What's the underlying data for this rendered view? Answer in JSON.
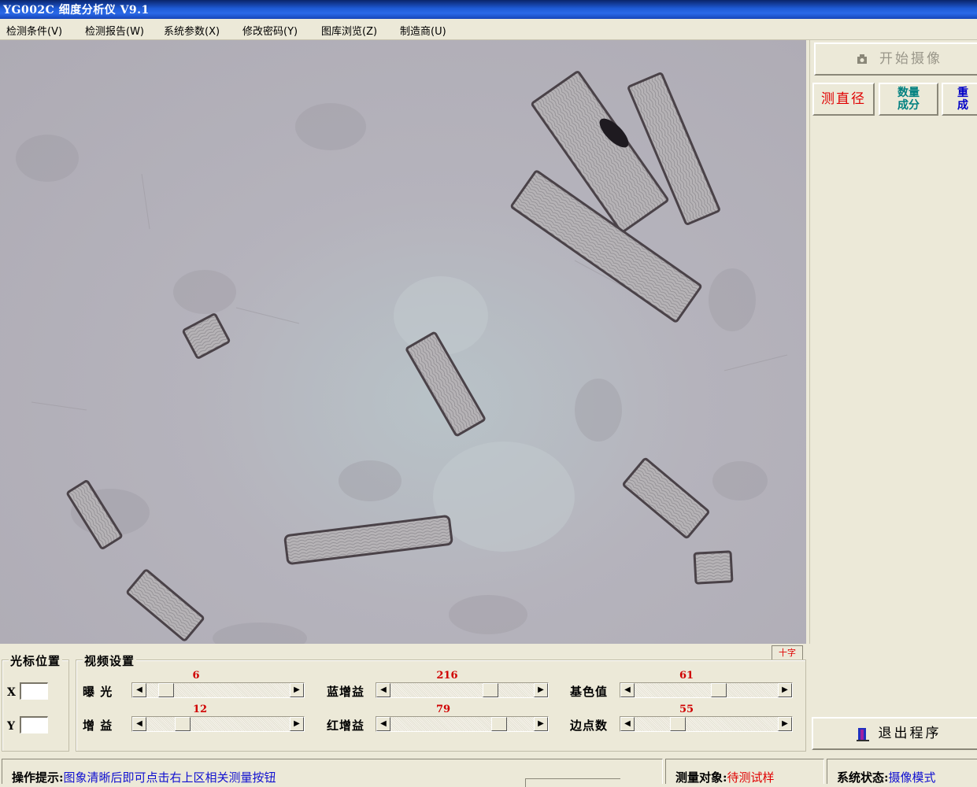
{
  "window": {
    "title": "YG002C 细度分析仪 V9.1"
  },
  "menu": [
    {
      "label": "检测条件(V)"
    },
    {
      "label": "检测报告(W)"
    },
    {
      "label": "系统参数(X)"
    },
    {
      "label": "修改密码(Y)"
    },
    {
      "label": "图库浏览(Z)"
    },
    {
      "label": "制造商(U)"
    }
  ],
  "toolbar": {
    "start_capture": "开始摄像",
    "measure_diameter": "测直径",
    "count_components_line1": "数量",
    "count_components_line2": "成分",
    "reset_components_line1": "重",
    "reset_components_line2": "成",
    "exit": "退出程序"
  },
  "crosshair_toggle": "十字",
  "cursor_position": {
    "title": "光标位置",
    "x_label": "X",
    "y_label": "Y",
    "x_value": "",
    "y_value": ""
  },
  "video_settings": {
    "title": "视频设置",
    "sliders": [
      {
        "label": "曝  光",
        "value": "6",
        "fraction": 0.09
      },
      {
        "label": "蓝增益",
        "value": "216",
        "fraction": 0.72
      },
      {
        "label": "基色值",
        "value": "61",
        "fraction": 0.6
      },
      {
        "label": "增  益",
        "value": "12",
        "fraction": 0.22
      },
      {
        "label": "红增益",
        "value": "79",
        "fraction": 0.79
      },
      {
        "label": "边点数",
        "value": "55",
        "fraction": 0.28
      }
    ]
  },
  "status": {
    "hint_label": "操作提示:",
    "hint_text": "图象清晰后即可点击右上区相关测量按钮",
    "target_label": "测量对象:",
    "target_value": "待测试样",
    "state_label": "系统状态:",
    "state_value": "摄像模式"
  },
  "colors": {
    "title_bar": "#1f5bd6",
    "red_text": "#e00000",
    "blue_text": "#1010d0",
    "teal_text": "#008080"
  },
  "icons": [
    "camera-icon",
    "exit-door-icon",
    "left-arrow-icon",
    "right-arrow-icon"
  ]
}
